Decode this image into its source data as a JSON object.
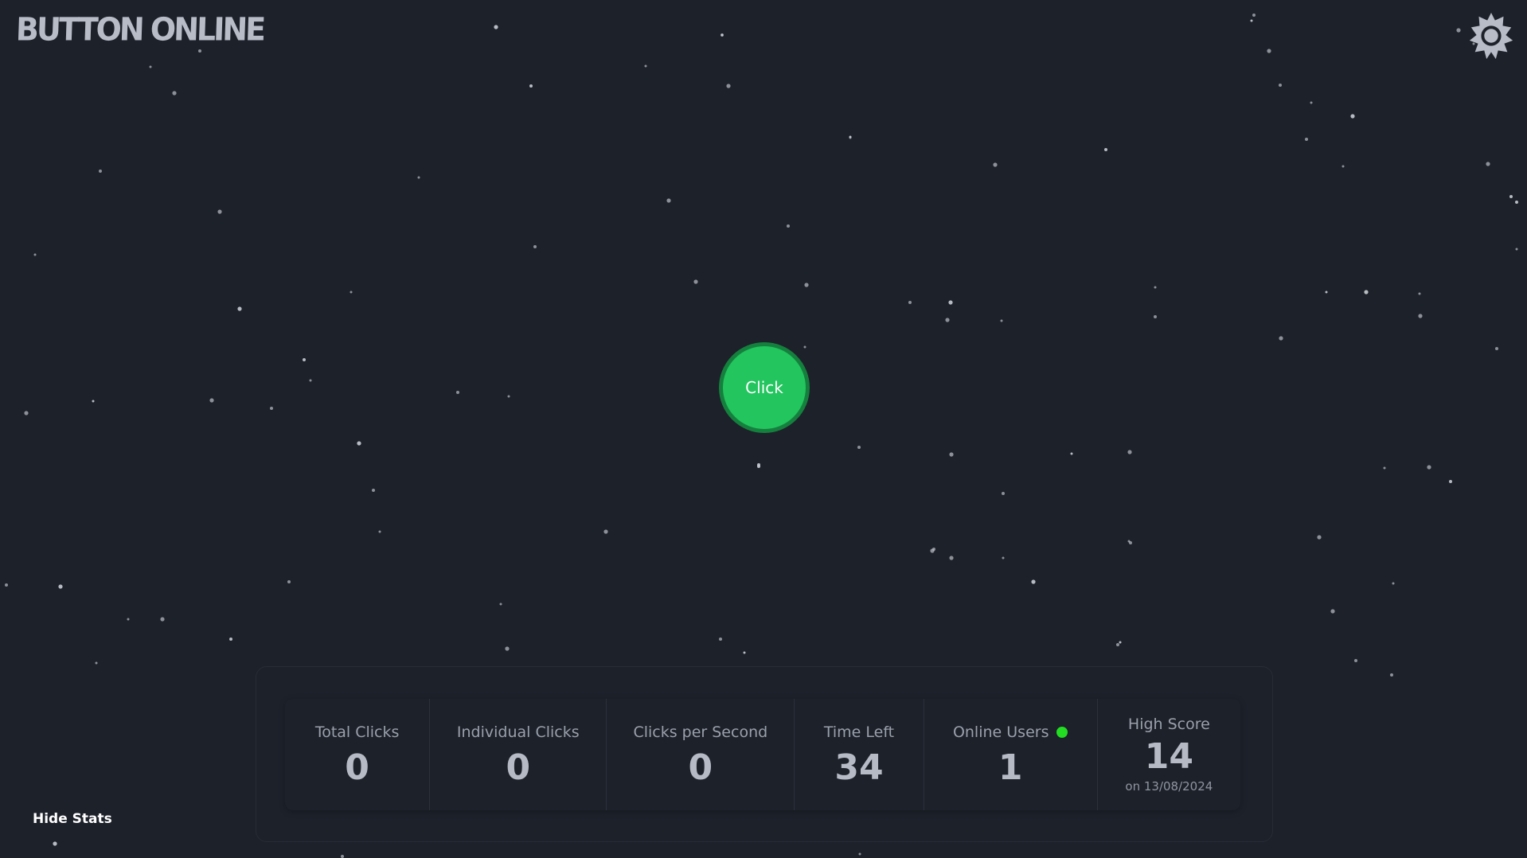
{
  "app": {
    "logo_text": "BUTTON ONLINE"
  },
  "header": {
    "settings_icon": "gear-icon"
  },
  "main": {
    "click_label": "Click",
    "click_color": "#22c55e"
  },
  "stats": {
    "total_clicks": {
      "label": "Total Clicks",
      "value": "0"
    },
    "individual_clicks": {
      "label": "Individual Clicks",
      "value": "0"
    },
    "clicks_per_second": {
      "label": "Clicks per Second",
      "value": "0"
    },
    "time_left": {
      "label": "Time Left",
      "value": "34"
    },
    "online_users": {
      "label": "Online Users",
      "value": "1",
      "status_color": "#22dd22"
    },
    "high_score": {
      "label": "High Score",
      "value": "14",
      "date": "on 13/08/2024"
    }
  },
  "footer": {
    "hide_stats_label": "Hide Stats"
  },
  "theme": {
    "background": "#1d212a",
    "star_color": "#c9ccd3"
  }
}
